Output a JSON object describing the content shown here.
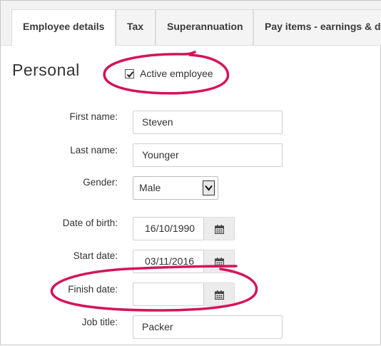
{
  "tabs": [
    {
      "label": "Employee details",
      "active": true
    },
    {
      "label": "Tax",
      "active": false
    },
    {
      "label": "Superannuation",
      "active": false
    },
    {
      "label": "Pay items - earnings & deductions",
      "active": false
    }
  ],
  "section": {
    "title": "Personal",
    "active_employee_label": "Active employee",
    "active_employee_checked": true
  },
  "fields": {
    "first_name": {
      "label": "First name:",
      "value": "Steven"
    },
    "last_name": {
      "label": "Last name:",
      "value": "Younger"
    },
    "gender": {
      "label": "Gender:",
      "value": "Male"
    },
    "date_of_birth": {
      "label": "Date of birth:",
      "value": "16/10/1990"
    },
    "start_date": {
      "label": "Start date:",
      "value": "03/11/2016"
    },
    "finish_date": {
      "label": "Finish date:",
      "value": ""
    },
    "job_title": {
      "label": "Job title:",
      "value": "Packer"
    }
  },
  "colors": {
    "highlight": "#d4145a",
    "tab_background": "#f4f4f4",
    "calendar_button": "#ececec"
  },
  "icons": [
    "checkmark-icon",
    "calendar-icon",
    "chevron-down-icon"
  ]
}
